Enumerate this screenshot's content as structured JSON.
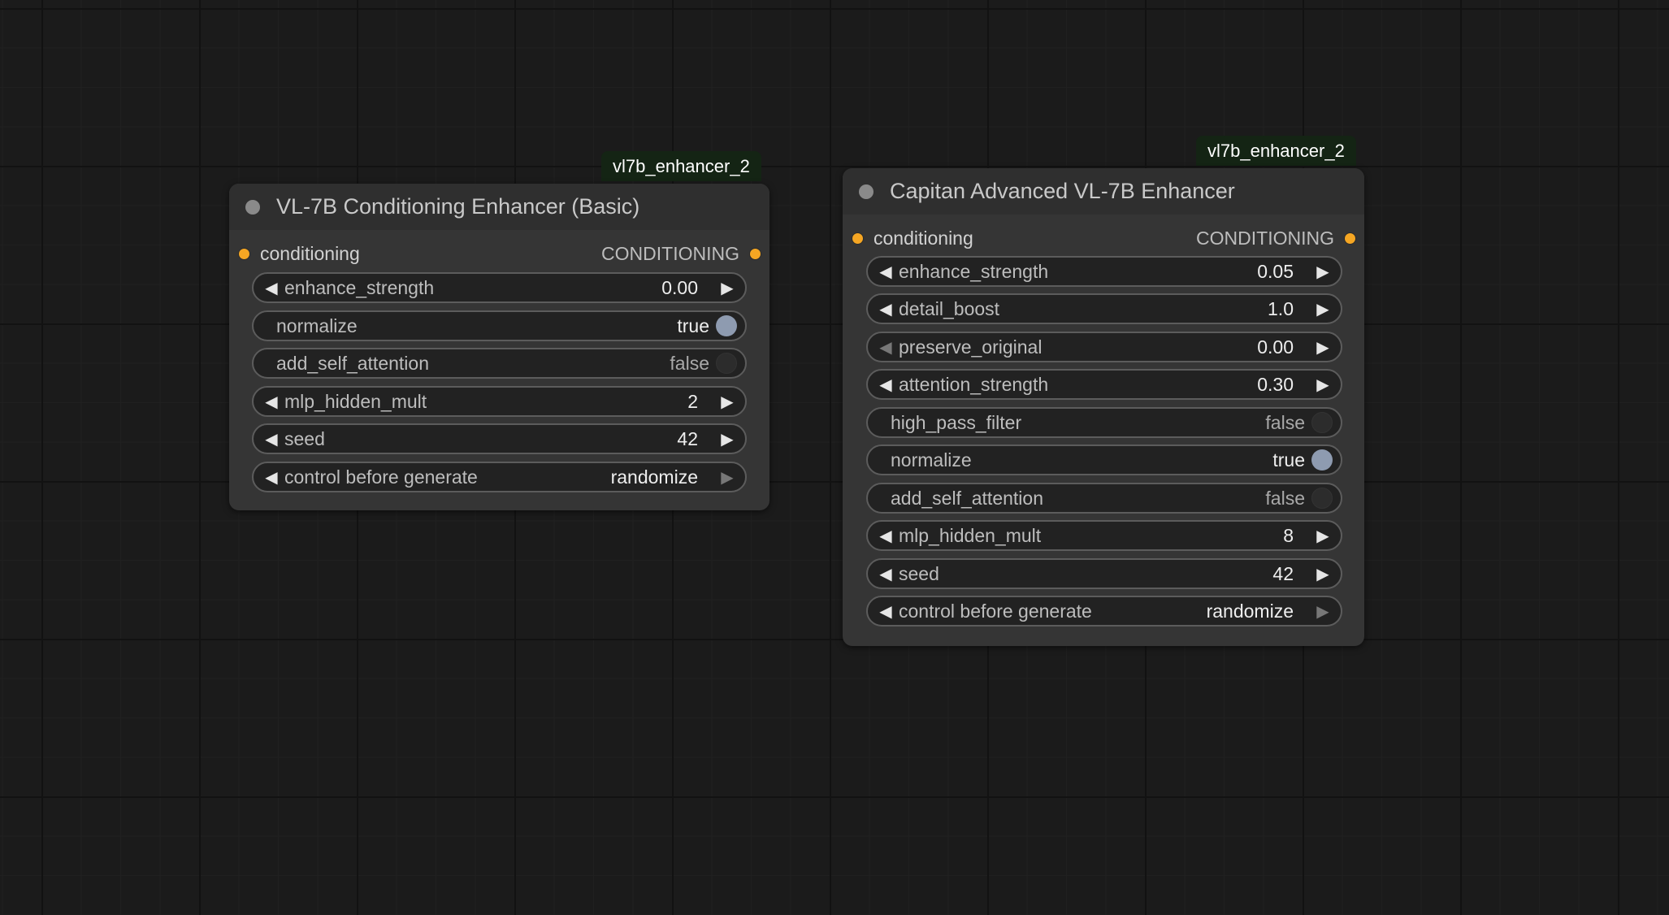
{
  "nodes": [
    {
      "badge": "vl7b_enhancer_2",
      "title": "VL-7B Conditioning Enhancer (Basic)",
      "input": {
        "name": "conditioning"
      },
      "output": {
        "type": "CONDITIONING"
      },
      "widgets": [
        {
          "kind": "number",
          "label": "enhance_strength",
          "value": "0.00"
        },
        {
          "kind": "toggle",
          "label": "normalize",
          "value": "true"
        },
        {
          "kind": "toggle",
          "label": "add_self_attention",
          "value": "false"
        },
        {
          "kind": "number",
          "label": "mlp_hidden_mult",
          "value": "2"
        },
        {
          "kind": "number",
          "label": "seed",
          "value": "42"
        },
        {
          "kind": "combo",
          "label": "control before generate",
          "value": "randomize"
        }
      ]
    },
    {
      "badge": "vl7b_enhancer_2",
      "title": "Capitan Advanced VL-7B Enhancer",
      "input": {
        "name": "conditioning"
      },
      "output": {
        "type": "CONDITIONING"
      },
      "widgets": [
        {
          "kind": "number",
          "label": "enhance_strength",
          "value": "0.05"
        },
        {
          "kind": "number",
          "label": "detail_boost",
          "value": "1.0"
        },
        {
          "kind": "number",
          "label": "preserve_original",
          "value": "0.00"
        },
        {
          "kind": "number",
          "label": "attention_strength",
          "value": "0.30"
        },
        {
          "kind": "toggle",
          "label": "high_pass_filter",
          "value": "false"
        },
        {
          "kind": "toggle",
          "label": "normalize",
          "value": "true"
        },
        {
          "kind": "toggle",
          "label": "add_self_attention",
          "value": "false"
        },
        {
          "kind": "number",
          "label": "mlp_hidden_mult",
          "value": "8"
        },
        {
          "kind": "number",
          "label": "seed",
          "value": "42"
        },
        {
          "kind": "combo",
          "label": "control before generate",
          "value": "randomize"
        }
      ]
    }
  ],
  "colors": {
    "canvas": "#1b1b1b",
    "node_body": "#353535",
    "node_header": "#2f2f2f",
    "badge_bg": "#142414",
    "slot_conditioning": "#f5a623",
    "toggle_on": "#8e9bb0"
  }
}
